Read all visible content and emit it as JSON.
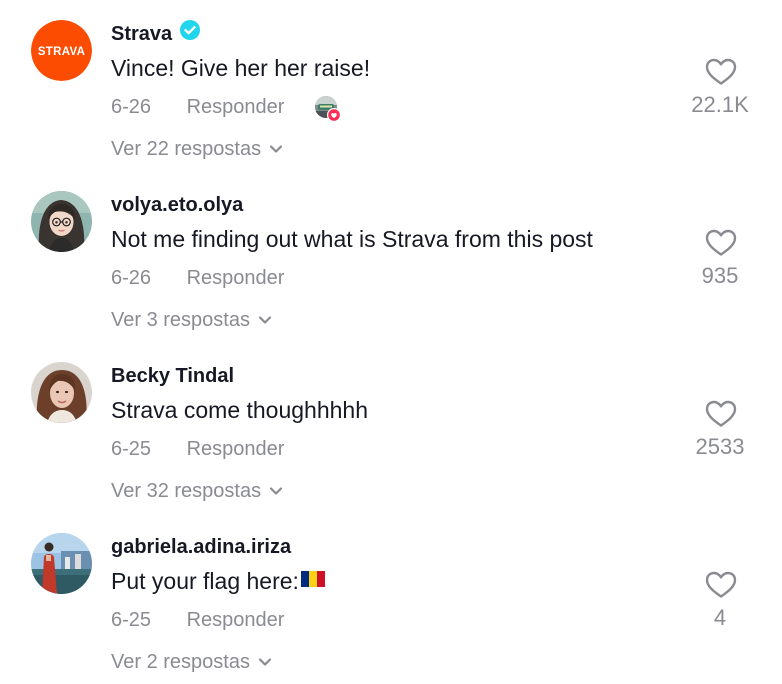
{
  "comments": [
    {
      "username": "Strava",
      "verified": true,
      "text": "Vince! Give her her raise!",
      "date": "6-26",
      "reply_label": "Responder",
      "replies_label": "Ver 22 respostas",
      "likes": "22.1K",
      "liked_by_creator": true,
      "avatar_logo_text": "STRAVA",
      "colors": {
        "avatar_bg": "#fc4c02"
      }
    },
    {
      "username": "volya.eto.olya",
      "verified": false,
      "text": "Not me finding out what is Strava from this post",
      "date": "6-26",
      "reply_label": "Responder",
      "replies_label": "Ver 3 respostas",
      "likes": "935"
    },
    {
      "username": "Becky Tindal",
      "verified": false,
      "text": "Strava come thoughhhhh",
      "date": "6-25",
      "reply_label": "Responder",
      "replies_label": "Ver 32 respostas",
      "likes": "2533"
    },
    {
      "username": "gabriela.adina.iriza",
      "verified": false,
      "text": "Put your flag here:",
      "text_emoji": "romania-flag",
      "date": "6-25",
      "reply_label": "Responder",
      "replies_label": "Ver 2 respostas",
      "likes": "4"
    }
  ],
  "icons": {
    "like": "heart-outline-icon",
    "verified": "verified-badge-icon",
    "expand": "chevron-down-icon"
  },
  "colors": {
    "text": "#161823",
    "secondary": "#8a8b91",
    "verified": "#20d5ec",
    "like_badge": "#fe2c55"
  }
}
